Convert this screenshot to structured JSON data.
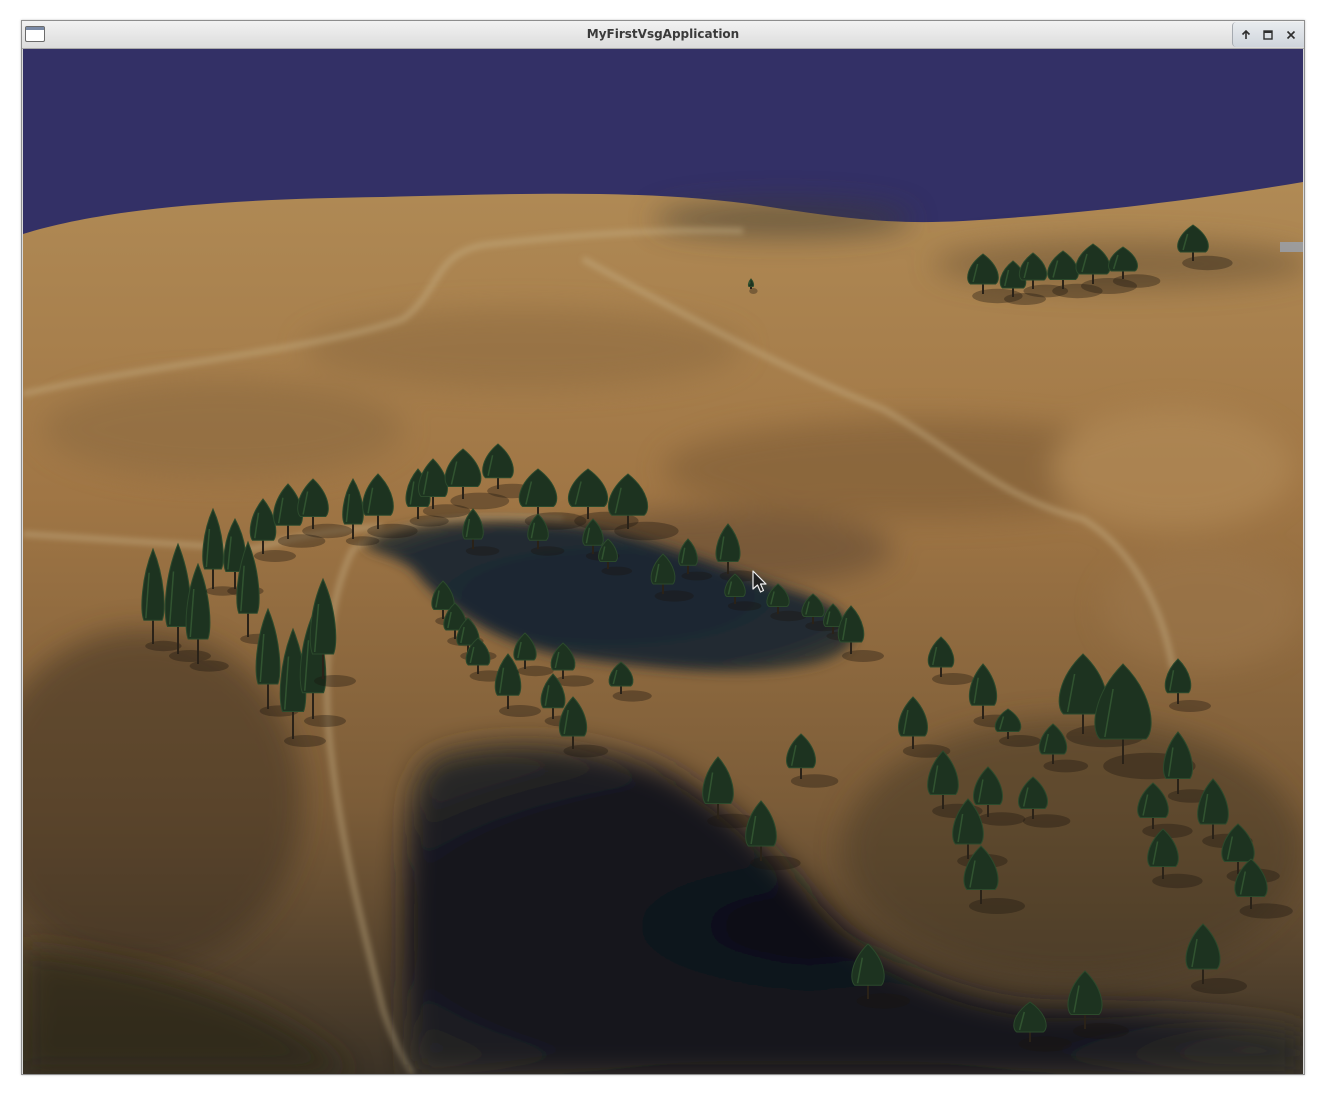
{
  "window": {
    "title": "MyFirstVsgApplication",
    "icons": {
      "menu": "window-menu-icon",
      "shade": "shade-up-icon",
      "maximize": "maximize-icon",
      "close": "close-icon"
    },
    "control_glyphs": {
      "shade": "↑",
      "maximize": "▫",
      "close": "✕"
    }
  },
  "scene": {
    "sky_color": "#333066",
    "terrain_color": "#a37a47",
    "water_color": "#151822",
    "tree_color": "#1d3320",
    "icons": [
      "tree-icon",
      "mouse-pointer-icon"
    ]
  }
}
